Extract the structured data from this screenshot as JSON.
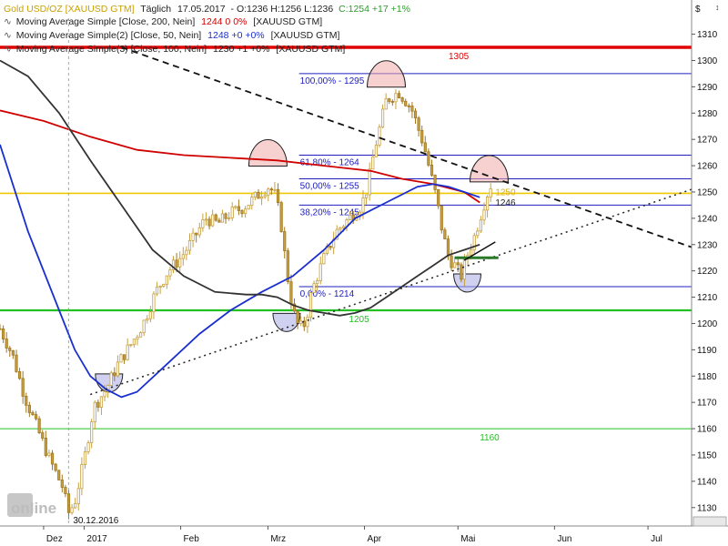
{
  "chart_data": {
    "type": "candlestick",
    "header": {
      "main": {
        "instrument": "Gold USD/OZ [XAUUSD GTM]",
        "interval": "Täglich",
        "date": "17.05.2017",
        "ohlc": "- O:1236 H:1256 L:1236",
        "close": "C:1254 +17 +1%",
        "instrument_color": "#c8a000",
        "close_color": "#2c9a2c"
      },
      "indicators": [
        {
          "label": "Moving Average Simple [Close, 200, Nein]",
          "value": "1244 0 0%",
          "symbol": "[XAUUSD GTM]",
          "color": "#d00000"
        },
        {
          "label": "Moving Average Simple(2) [Close, 50, Nein]",
          "value": "1248 +0 +0%",
          "symbol": "[XAUUSD GTM]",
          "color": "#1a2fd0"
        },
        {
          "label": "Moving Average Simple(3) [Close, 100, Nein]",
          "value": "1230 +1 +0%",
          "symbol": "[XAUUSD GTM]",
          "color": "#222222"
        }
      ]
    },
    "currency_symbol": "$",
    "y_axis": {
      "min": 1123,
      "max": 1323,
      "ticks": [
        1130,
        1140,
        1150,
        1160,
        1170,
        1180,
        1190,
        1200,
        1210,
        1220,
        1230,
        1240,
        1250,
        1260,
        1270,
        1280,
        1290,
        1300,
        1310
      ]
    },
    "x_axis": {
      "labels": [
        "Dez",
        "2017",
        "Feb",
        "Mrz",
        "Apr",
        "Mai",
        "Jun",
        "Jul"
      ],
      "label_days": [
        -10,
        3,
        34,
        62,
        93,
        123,
        154,
        184
      ],
      "range_days": [
        -24,
        198
      ]
    },
    "date_marker": {
      "label": "30.12.2016",
      "day": -2
    },
    "horizontal_levels": [
      {
        "value": 1305,
        "label": "1305",
        "color": "#e00000",
        "width": 3.5,
        "label_day": 120
      },
      {
        "value": 1249.5,
        "label": "",
        "color": "#f0c800",
        "width": 1.6
      },
      {
        "value": 1205,
        "label": "1205",
        "color": "#22c022",
        "width": 2.2,
        "label_day": 88
      },
      {
        "value": 1160,
        "label": "1160",
        "color": "#22c022",
        "width": 1,
        "label_day": 130
      },
      {
        "value": 1230,
        "label": "",
        "color": "#2a7a2a",
        "width": 0
      }
    ],
    "fibonacci": {
      "color": "#2020c0",
      "start_day": 72,
      "end_day": 198,
      "levels": [
        {
          "value": 1295,
          "label": "100,00% - 1295"
        },
        {
          "value": 1264,
          "label": "61,80% - 1264"
        },
        {
          "value": 1255,
          "label": "50,00% - 1255"
        },
        {
          "value": 1245,
          "label": "38,20% - 1245"
        },
        {
          "value": 1214,
          "label": "0,00% - 1214"
        }
      ]
    },
    "last_price_labels": [
      {
        "value": 1250,
        "label": "1250",
        "color": "#d8b020"
      },
      {
        "value": 1246,
        "label": "1246",
        "color": "#222222"
      }
    ],
    "trendlines": [
      {
        "name": "resistance",
        "style": "dashed",
        "x": [
          15,
          198
        ],
        "y": [
          1305,
          1229
        ]
      },
      {
        "name": "support",
        "style": "dotted",
        "x": [
          5,
          198
        ],
        "y": [
          1173,
          1251
        ]
      },
      {
        "name": "neckline",
        "style": "solid-green",
        "x": [
          122,
          136
        ],
        "y": [
          1225,
          1225
        ]
      },
      {
        "name": "ma-touch",
        "style": "solid-black",
        "x": [
          125,
          135
        ],
        "y": [
          1224,
          1231
        ]
      }
    ],
    "annotations": [
      {
        "type": "top-arc",
        "day": 62,
        "value": 1264
      },
      {
        "type": "top-arc",
        "day": 100,
        "value": 1294
      },
      {
        "type": "top-arc",
        "day": 133,
        "value": 1258
      },
      {
        "type": "bottom-arc",
        "day": 11,
        "value": 1176
      },
      {
        "type": "bottom-arc",
        "day": 68,
        "value": 1199
      },
      {
        "type": "bottom-arc",
        "day": 126,
        "value": 1214
      }
    ],
    "series": [
      {
        "name": "Moving Average Simple [Close, 200, Nein]",
        "color": "#d00000",
        "x": [
          -24,
          -10,
          5,
          20,
          35,
          50,
          65,
          80,
          95,
          105,
          115,
          125,
          130
        ],
        "y": [
          1281,
          1277,
          1271,
          1266,
          1264,
          1263,
          1262,
          1260,
          1258,
          1255,
          1253,
          1250,
          1246
        ]
      },
      {
        "name": "Moving Average Simple(2) [Close, 50, Nein]",
        "color": "#1a2fd0",
        "x": [
          -24,
          -15,
          -5,
          0,
          5,
          10,
          15,
          20,
          30,
          40,
          50,
          60,
          70,
          80,
          90,
          100,
          110,
          115,
          120,
          125,
          130
        ],
        "y": [
          1268,
          1235,
          1205,
          1190,
          1180,
          1175,
          1172,
          1174,
          1185,
          1196,
          1205,
          1212,
          1218,
          1228,
          1240,
          1246,
          1252,
          1253,
          1252,
          1250,
          1248
        ]
      },
      {
        "name": "Moving Average Simple(3) [Close, 100, Nein]",
        "color": "#333333",
        "x": [
          -24,
          -15,
          -5,
          5,
          15,
          25,
          35,
          45,
          55,
          60,
          65,
          70,
          75,
          80,
          85,
          90,
          95,
          100,
          105,
          110,
          115,
          120,
          125,
          130
        ],
        "y": [
          1300,
          1294,
          1280,
          1262,
          1245,
          1228,
          1218,
          1212,
          1211,
          1211,
          1210,
          1207,
          1205,
          1204,
          1203,
          1204,
          1206,
          1210,
          1214,
          1218,
          1222,
          1226,
          1228,
          1230
        ]
      }
    ],
    "price_path": {
      "x": [
        -24,
        -20,
        -16,
        -12,
        -8,
        -4,
        -2,
        0,
        3,
        6,
        10,
        14,
        18,
        22,
        26,
        30,
        34,
        38,
        42,
        46,
        50,
        54,
        58,
        62,
        64,
        66,
        68,
        70,
        72,
        74,
        76,
        80,
        84,
        88,
        92,
        94,
        96,
        100,
        104,
        108,
        110,
        112,
        114,
        116,
        118,
        120,
        122,
        124,
        126,
        128,
        130,
        132,
        134
      ],
      "y": [
        1198,
        1188,
        1172,
        1160,
        1148,
        1138,
        1128,
        1132,
        1148,
        1168,
        1175,
        1185,
        1192,
        1200,
        1212,
        1220,
        1225,
        1232,
        1240,
        1238,
        1242,
        1244,
        1248,
        1252,
        1250,
        1240,
        1220,
        1205,
        1198,
        1200,
        1212,
        1225,
        1235,
        1240,
        1245,
        1252,
        1265,
        1285,
        1288,
        1282,
        1275,
        1268,
        1258,
        1248,
        1235,
        1225,
        1222,
        1218,
        1226,
        1232,
        1240,
        1248,
        1254
      ]
    }
  }
}
